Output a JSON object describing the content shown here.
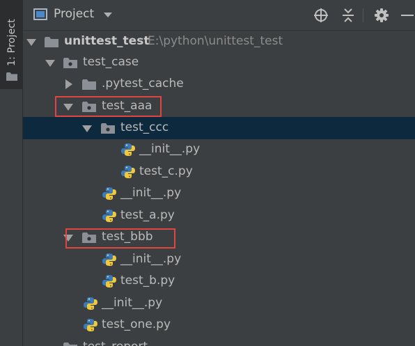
{
  "side_panel": {
    "tab_label": "1: Project"
  },
  "header": {
    "title": "Project"
  },
  "tree": {
    "root": {
      "name": "unittest_test",
      "path": "E:\\python\\unittest_test"
    },
    "test_case": "test_case",
    "pytest_cache": ".pytest_cache",
    "test_aaa": "test_aaa",
    "test_ccc": "test_ccc",
    "ccc_init": "__init__.py",
    "ccc_file": "test_c.py",
    "aaa_init": "__init__.py",
    "aaa_file": "test_a.py",
    "test_bbb": "test_bbb",
    "bbb_init": "__init__.py",
    "bbb_file": "test_b.py",
    "case_init": "__init__.py",
    "case_file": "test_one.py",
    "test_report": "test_report"
  },
  "colors": {
    "selection": "#0d293e",
    "highlight_box": "#e0463f",
    "folder": "#8a9096",
    "python_blue": "#3d7ab8",
    "python_yellow": "#f0c93a"
  }
}
